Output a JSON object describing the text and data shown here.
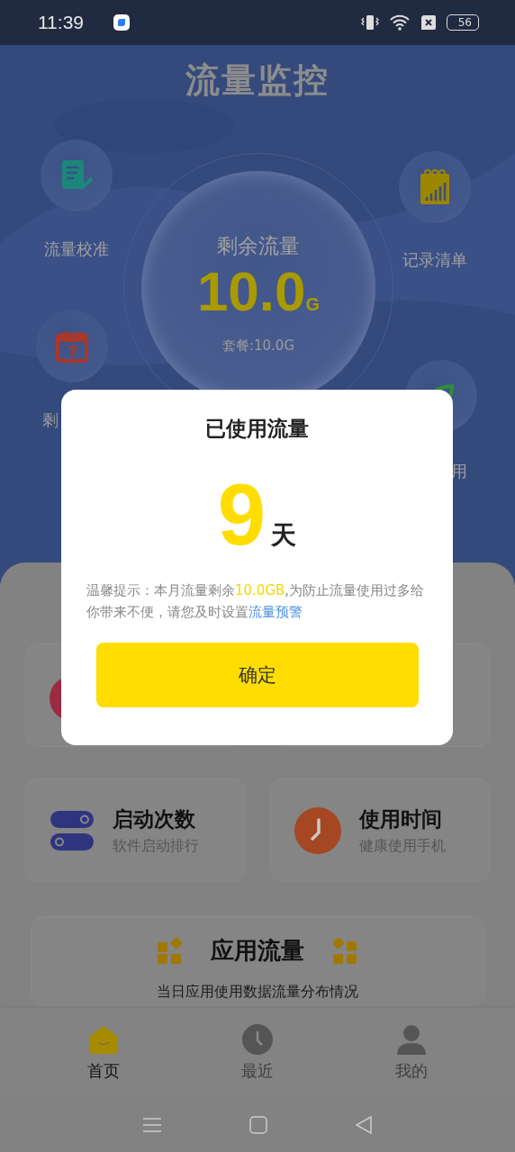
{
  "status_bar": {
    "time": "11:39",
    "battery": "56"
  },
  "header": {
    "title": "流量监控"
  },
  "shortcuts": [
    {
      "label": "流量校准",
      "kind": "calibrate"
    },
    {
      "label": "记录清单",
      "kind": "records"
    },
    {
      "label": "剩",
      "kind": "calendar"
    },
    {
      "label": "用",
      "kind": "leaf"
    }
  ],
  "gauge": {
    "label": "剩余流量",
    "value": "10.0",
    "unit": "G",
    "plan": "套餐:10.0G"
  },
  "features": [
    {
      "title": "启动次数",
      "subtitle": "软件启动排行",
      "kind": "toggles"
    },
    {
      "title": "使用时间",
      "subtitle": "健康使用手机",
      "kind": "clock"
    }
  ],
  "app_traffic": {
    "title": "应用流量",
    "subtitle": "当日应用使用数据流量分布情况"
  },
  "tabs": [
    {
      "label": "首页",
      "selected": true,
      "kind": "home"
    },
    {
      "label": "最近",
      "selected": false,
      "kind": "clock"
    },
    {
      "label": "我的",
      "selected": false,
      "kind": "person"
    }
  ],
  "dialog": {
    "title": "已使用流量",
    "days": "9",
    "unit": "天",
    "tip_before": "温馨提示：本月流量剩余",
    "tip_highlight": "10.0GB",
    "tip_after": ",为防止流量使用过多给你带来不便，请您及时设置",
    "link": "流量预警",
    "button": "确定"
  }
}
